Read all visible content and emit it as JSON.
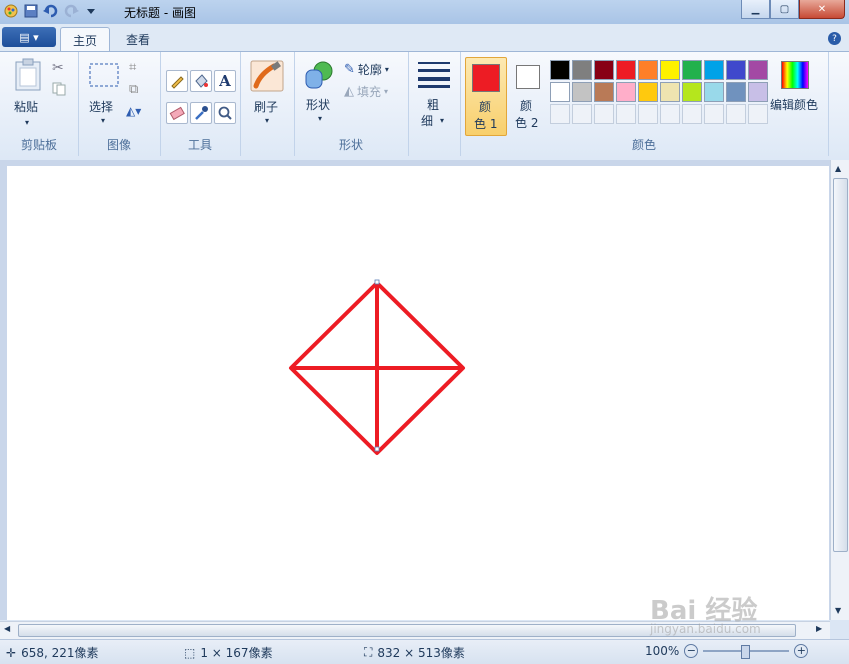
{
  "window": {
    "title": "无标题 - 画图"
  },
  "tabs": {
    "home": "主页",
    "view": "查看"
  },
  "clipboard": {
    "paste": "粘贴",
    "group": "剪贴板"
  },
  "image": {
    "select": "选择",
    "group": "图像"
  },
  "tools": {
    "group": "工具"
  },
  "brushes": {
    "label": "刷子"
  },
  "shapes": {
    "label": "形状",
    "outline": "轮廓",
    "fill": "填充",
    "group": "形状"
  },
  "size": {
    "line1": "粗",
    "line2": "细"
  },
  "colors": {
    "color1_line1": "颜",
    "color1_line2": "色 1",
    "color2_line1": "颜",
    "color2_line2": "色 2",
    "edit": "编辑颜色",
    "group": "颜色",
    "color1": "#ed1c24",
    "color2": "#ffffff",
    "palette_row1": [
      "#000000",
      "#7f7f7f",
      "#880015",
      "#ed1c24",
      "#ff7f27",
      "#fff200",
      "#22b14c",
      "#00a2e8",
      "#3f48cc",
      "#a349a4"
    ],
    "palette_row2": [
      "#ffffff",
      "#c3c3c3",
      "#b97a57",
      "#ffaec9",
      "#ffc90e",
      "#efe4b0",
      "#b5e61d",
      "#99d9ea",
      "#7092be",
      "#c8bfe7"
    ]
  },
  "drawing": {
    "stroke": "#ed1c24"
  },
  "status": {
    "cursor": "658, 221像素",
    "selection": "1 × 167像素",
    "canvas_size": "832 × 513像素",
    "zoom": "100%"
  },
  "watermark": {
    "text": "Bai 经验",
    "sub": "jingyan.baidu.com"
  }
}
